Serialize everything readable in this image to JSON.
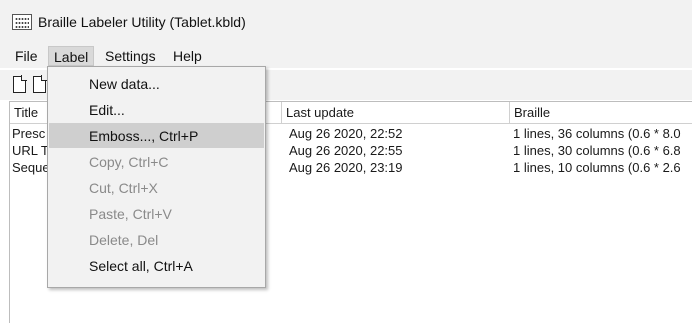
{
  "window": {
    "title": "Braille Labeler Utility (Tablet.kbld)"
  },
  "menubar": {
    "items": [
      "File",
      "Label",
      "Settings",
      "Help"
    ]
  },
  "columns": {
    "title": "Title",
    "last_update": "Last update",
    "braille": "Braille"
  },
  "rows": [
    {
      "title": "Presc",
      "last_update": "Aug 26 2020, 22:52",
      "braille": "1 lines, 36 columns (0.6 * 8.0"
    },
    {
      "title": "URL T",
      "last_update": "Aug 26 2020, 22:55",
      "braille": "1 lines, 30 columns (0.6 * 6.8"
    },
    {
      "title": "Seque",
      "last_update": "Aug 26 2020, 23:19",
      "braille": "1 lines, 10 columns (0.6 * 2.6"
    }
  ],
  "label_menu": {
    "items": [
      {
        "label": "New data...",
        "enabled": true,
        "highlighted": false
      },
      {
        "label": "Edit...",
        "enabled": true,
        "highlighted": false
      },
      {
        "label": "Emboss..., Ctrl+P",
        "enabled": true,
        "highlighted": true
      },
      {
        "label": "Copy, Ctrl+C",
        "enabled": false,
        "highlighted": false
      },
      {
        "label": "Cut, Ctrl+X",
        "enabled": false,
        "highlighted": false
      },
      {
        "label": "Paste, Ctrl+V",
        "enabled": false,
        "highlighted": false
      },
      {
        "label": "Delete, Del",
        "enabled": false,
        "highlighted": false
      },
      {
        "label": "Select all, Ctrl+A",
        "enabled": true,
        "highlighted": false
      }
    ]
  },
  "icons": {
    "app": "braille-grid-icon",
    "new": "new-document-icon",
    "open": "open-document-icon"
  },
  "colors": {
    "menu_bg": "#f2f2f2",
    "highlight": "#cfcfcf",
    "disabled_text": "#8a8a8a"
  }
}
